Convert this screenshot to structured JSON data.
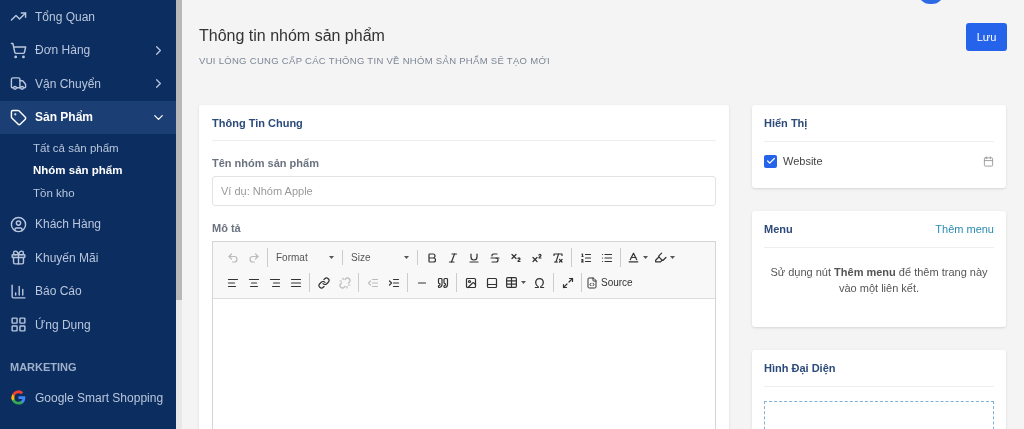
{
  "sidebar": {
    "items": [
      {
        "label": "Tổng Quan",
        "selected": false
      },
      {
        "label": "Đơn Hàng",
        "selected": false,
        "expanded": false
      },
      {
        "label": "Vận Chuyển",
        "selected": false,
        "expanded": false
      },
      {
        "label": "Sản Phẩm",
        "selected": true,
        "expanded": true,
        "children": [
          {
            "label": "Tất cả sản phẩm",
            "selected": false
          },
          {
            "label": "Nhóm sản phẩm",
            "selected": true
          },
          {
            "label": "Tồn kho",
            "selected": false
          }
        ]
      },
      {
        "label": "Khách Hàng",
        "selected": false
      },
      {
        "label": "Khuyến Mãi",
        "selected": false
      },
      {
        "label": "Báo Cáo",
        "selected": false
      },
      {
        "label": "Ứng Dụng",
        "selected": false
      }
    ],
    "sections": [
      {
        "title": "MARKETING",
        "items": [
          {
            "label": "Google Smart Shopping",
            "selected": false
          }
        ]
      }
    ]
  },
  "header": {
    "title": "Thông tin nhóm sản phẩm",
    "subtitle": "VUI LÒNG CUNG CẤP CÁC THÔNG TIN VỀ NHÓM SẢN PHẨM SẼ TẠO MỚI",
    "save_button": "Lưu"
  },
  "general_card": {
    "title": "Thông Tin Chung",
    "name_field": {
      "label": "Tên nhóm sản phẩm",
      "placeholder": "Ví dụ: Nhóm Apple"
    },
    "description": {
      "label": "Mô tả",
      "toolbar": [
        [
          [
            {
              "kind": "icon",
              "disabled": true
            },
            {
              "kind": "icon",
              "disabled": true
            }
          ],
          [
            {
              "kind": "combo",
              "label": "Format"
            }
          ],
          [
            {
              "kind": "combo",
              "label": "Size"
            }
          ],
          [
            {
              "kind": "icon",
              "disabled": false
            },
            {
              "kind": "icon",
              "disabled": false
            },
            {
              "kind": "icon",
              "disabled": false
            },
            {
              "kind": "icon",
              "disabled": false
            },
            {
              "kind": "icon",
              "disabled": false
            },
            {
              "kind": "icon",
              "disabled": false
            },
            {
              "kind": "icon",
              "disabled": false
            }
          ],
          [
            {
              "kind": "icon",
              "disabled": false
            },
            {
              "kind": "icon",
              "disabled": false
            }
          ],
          [
            {
              "kind": "menu_icon",
              "disabled": false
            },
            {
              "kind": "menu_icon",
              "disabled": false
            }
          ]
        ],
        [
          [
            {
              "kind": "icon",
              "disabled": false
            },
            {
              "kind": "icon",
              "disabled": false
            },
            {
              "kind": "icon",
              "disabled": false
            },
            {
              "kind": "icon",
              "disabled": false
            }
          ],
          [
            {
              "kind": "icon",
              "disabled": false
            },
            {
              "kind": "icon",
              "disabled": true
            }
          ],
          [
            {
              "kind": "icon",
              "disabled": true
            },
            {
              "kind": "icon",
              "disabled": false
            }
          ],
          [
            {
              "kind": "icon",
              "disabled": false
            },
            {
              "kind": "icon",
              "disabled": false
            }
          ],
          [
            {
              "kind": "icon",
              "disabled": false
            },
            {
              "kind": "icon",
              "disabled": false
            },
            {
              "kind": "menu_icon",
              "disabled": false
            },
            {
              "kind": "glyph",
              "label": "Ω",
              "disabled": false
            }
          ],
          [
            {
              "kind": "icon",
              "disabled": false
            }
          ],
          [
            {
              "kind": "text_button",
              "label": "Source",
              "disabled": false
            }
          ]
        ]
      ]
    }
  },
  "display_card": {
    "title": "Hiển Thị",
    "channels": [
      {
        "label": "Website",
        "checked": true
      }
    ]
  },
  "menu_card": {
    "title": "Menu",
    "action": "Thêm menu",
    "hint": "Sử dụng nút **Thêm menu** để thêm trang này vào một liên kết."
  },
  "image_card": {
    "title": "Hình Đại Diện"
  }
}
